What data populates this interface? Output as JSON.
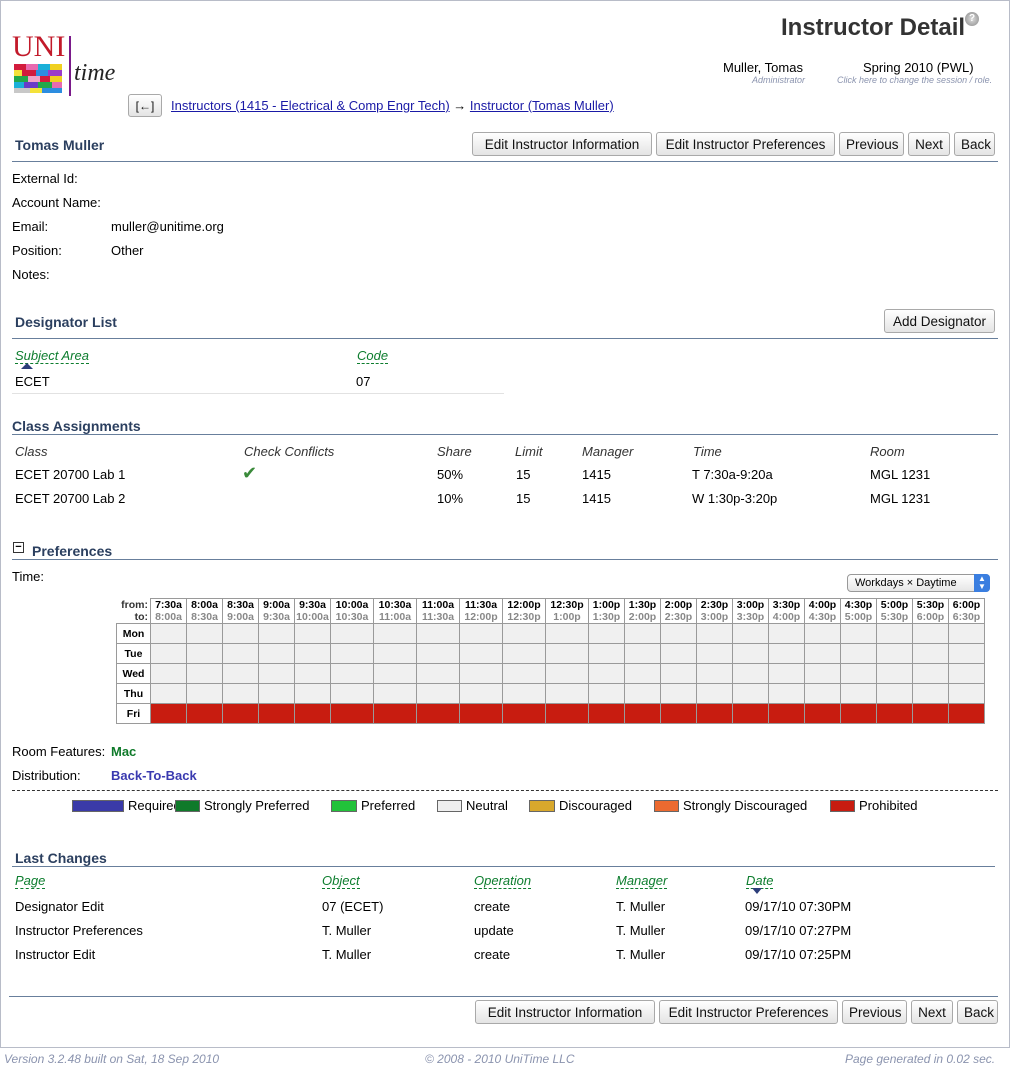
{
  "header": {
    "page_title": "Instructor Detail",
    "help_icon": "question-circle-icon",
    "logo_text_uni": "UNI",
    "logo_text_time": "time",
    "user_name": "Muller, Tomas",
    "user_role": "Administrator",
    "session": "Spring 2010 (PWL)",
    "session_hint": "Click here to change the session / role."
  },
  "breadcrumb": {
    "back_label": "[←]",
    "crumb1": "Instructors (1415 - Electrical & Comp Engr Tech)",
    "arrow": "→",
    "crumb2": "Instructor (Tomas Muller)"
  },
  "instructor": {
    "name": "Tomas Muller",
    "fields": {
      "external_id_label": "External Id:",
      "external_id": "",
      "account_name_label": "Account Name:",
      "account_name": "",
      "email_label": "Email:",
      "email": "muller@unitime.org",
      "position_label": "Position:",
      "position": "Other",
      "notes_label": "Notes:",
      "notes": ""
    }
  },
  "buttons": {
    "edit_info": "Edit Instructor Information",
    "edit_prefs": "Edit Instructor Preferences",
    "previous": "Previous",
    "next": "Next",
    "back": "Back",
    "add_designator": "Add Designator"
  },
  "designators": {
    "title": "Designator List",
    "headers": [
      "Subject Area",
      "Code"
    ],
    "rows": [
      [
        "ECET",
        "07"
      ]
    ]
  },
  "assignments": {
    "title": "Class Assignments",
    "headers": [
      "Class",
      "Check Conflicts",
      "Share",
      "Limit",
      "Manager",
      "Time",
      "Room"
    ],
    "rows": [
      [
        "ECET 20700 Lab 1",
        "✔",
        "50%",
        "15",
        "1415",
        "T 7:30a-9:20a",
        "MGL 1231"
      ],
      [
        "ECET 20700 Lab 2",
        "",
        "10%",
        "15",
        "1415",
        "W 1:30p-3:20p",
        "MGL 1231"
      ]
    ]
  },
  "preferences": {
    "title": "Preferences",
    "toggle": "−",
    "time_label": "Time:",
    "time_pattern": "Workdays × Daytime",
    "from_label": "from:",
    "to_label": "to:",
    "from": [
      "7:30a",
      "8:00a",
      "8:30a",
      "9:00a",
      "9:30a",
      "10:00a",
      "10:30a",
      "11:00a",
      "11:30a",
      "12:00p",
      "12:30p",
      "1:00p",
      "1:30p",
      "2:00p",
      "2:30p",
      "3:00p",
      "3:30p",
      "4:00p",
      "4:30p",
      "5:00p",
      "5:30p",
      "6:00p"
    ],
    "to": [
      "8:00a",
      "8:30a",
      "9:00a",
      "9:30a",
      "10:00a",
      "10:30a",
      "11:00a",
      "11:30a",
      "12:00p",
      "12:30p",
      "1:00p",
      "1:30p",
      "2:00p",
      "2:30p",
      "3:00p",
      "3:30p",
      "4:00p",
      "4:30p",
      "5:00p",
      "5:30p",
      "6:00p",
      "6:30p"
    ],
    "days": [
      "Mon",
      "Tue",
      "Wed",
      "Thu",
      "Fri"
    ],
    "day_prefs": [
      "neutral",
      "neutral",
      "neutral",
      "neutral",
      "prohibited"
    ],
    "room_features_label": "Room Features:",
    "room_features": "Mac",
    "distribution_label": "Distribution:",
    "distribution": "Back-To-Back",
    "legend": [
      {
        "label": "Required",
        "color": "#3a3aa8"
      },
      {
        "label": "Strongly Preferred",
        "color": "#0f7a2a"
      },
      {
        "label": "Preferred",
        "color": "#22c23a"
      },
      {
        "label": "Neutral",
        "color": "#efefef"
      },
      {
        "label": "Discouraged",
        "color": "#d8a82c"
      },
      {
        "label": "Strongly Discouraged",
        "color": "#ec6a30"
      },
      {
        "label": "Prohibited",
        "color": "#c81c10"
      }
    ]
  },
  "changes": {
    "title": "Last Changes",
    "headers": [
      "Page",
      "Object",
      "Operation",
      "Manager",
      "Date"
    ],
    "rows": [
      [
        "Designator Edit",
        "07 (ECET)",
        "create",
        "T. Muller",
        "09/17/10 07:30PM"
      ],
      [
        "Instructor Preferences",
        "T. Muller",
        "update",
        "T. Muller",
        "09/17/10 07:27PM"
      ],
      [
        "Instructor Edit",
        "T. Muller",
        "create",
        "T. Muller",
        "09/17/10 07:25PM"
      ]
    ]
  },
  "footer": {
    "version": "Version 3.2.48 built on Sat, 18 Sep 2010",
    "copyright": "© 2008 - 2010 UniTime LLC",
    "generated": "Page generated in 0.02 sec."
  }
}
